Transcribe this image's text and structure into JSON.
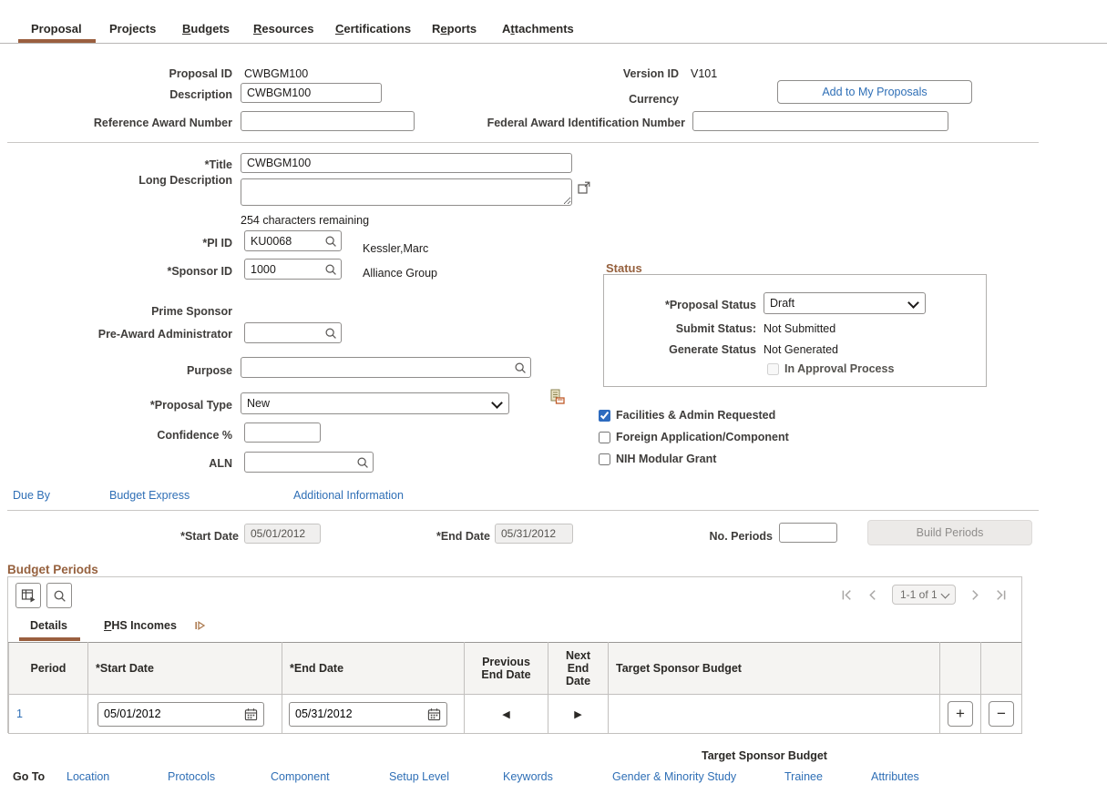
{
  "tabs": {
    "items": [
      {
        "pre": "Proposal",
        "key": "",
        "rest": ""
      },
      {
        "pre": "Projects",
        "key": "",
        "rest": ""
      },
      {
        "pre": "",
        "key": "B",
        "rest": "udgets"
      },
      {
        "pre": "",
        "key": "R",
        "rest": "esources"
      },
      {
        "pre": "",
        "key": "C",
        "rest": "ertifications"
      },
      {
        "pre": "R",
        "key": "e",
        "rest": "ports"
      },
      {
        "pre": "A",
        "key": "t",
        "rest": "tachments"
      }
    ]
  },
  "header": {
    "proposal_id_label": "Proposal ID",
    "proposal_id_value": "CWBGM100",
    "version_id_label": "Version ID",
    "version_id_value": "V101",
    "description_label": "Description",
    "description_value": "CWBGM100",
    "currency_label": "Currency",
    "add_to_my_proposals": "Add to My Proposals",
    "reference_award_label": "Reference Award Number",
    "reference_award_value": "",
    "federal_award_label": "Federal Award Identification Number",
    "federal_award_value": ""
  },
  "details": {
    "title_label": "*Title",
    "title_value": "CWBGM100",
    "long_description_label": "Long Description",
    "long_description_value": "",
    "chars_remaining": "254 characters remaining",
    "pi_id_label": "*PI ID",
    "pi_id_value": "KU0068",
    "pi_name": "Kessler,Marc",
    "sponsor_id_label": "*Sponsor ID",
    "sponsor_id_value": "1000",
    "sponsor_name": "Alliance Group",
    "prime_sponsor_label": "Prime Sponsor",
    "pre_award_admin_label": "Pre-Award Administrator",
    "pre_award_admin_value": "",
    "purpose_label": "Purpose",
    "purpose_value": "",
    "proposal_type_label": "*Proposal Type",
    "proposal_type_value": "New",
    "confidence_label": "Confidence %",
    "confidence_value": "",
    "aln_label": "ALN",
    "aln_value": ""
  },
  "status": {
    "heading": "Status",
    "proposal_status_label": "*Proposal Status",
    "proposal_status_value": "Draft",
    "submit_status_label": "Submit Status:",
    "submit_status_value": "Not Submitted",
    "generate_status_label": "Generate Status",
    "generate_status_value": "Not Generated",
    "in_approval_label": "In Approval Process"
  },
  "flags": [
    {
      "label": "Facilities & Admin Requested",
      "checked": true
    },
    {
      "label": "Foreign Application/Component",
      "checked": false
    },
    {
      "label": "NIH Modular Grant",
      "checked": false
    }
  ],
  "quick_links": [
    "Due By",
    "Budget Express",
    "Additional Information"
  ],
  "period_setup": {
    "start_date_label": "*Start Date",
    "start_date_value": "05/01/2012",
    "end_date_label": "*End Date",
    "end_date_value": "05/31/2012",
    "no_periods_label": "No. Periods",
    "no_periods_value": "",
    "build_periods_label": "Build Periods"
  },
  "budget_periods": {
    "heading": "Budget Periods",
    "tab_details": "Details",
    "tab_phs": {
      "key": "P",
      "rest": "HS Incomes"
    },
    "pagination": "1-1 of 1",
    "columns": [
      "Period",
      "*Start Date",
      "*End Date",
      "Previous End Date",
      "Next End Date",
      "Target Sponsor Budget"
    ],
    "rows": [
      {
        "period": "1",
        "start_date": "05/01/2012",
        "end_date": "05/31/2012"
      }
    ]
  },
  "footer": {
    "target_sponsor_budget_label": "Target Sponsor Budget",
    "go_to_label": "Go To",
    "links": [
      "Location",
      "Protocols",
      "Component",
      "Setup Level",
      "Keywords",
      "Gender & Minority Study",
      "Trainee",
      "Attributes"
    ]
  },
  "icons": {
    "plus": "+",
    "minus": "−",
    "prev": "◀",
    "next": "▶"
  },
  "colors": {
    "accent_brown": "#9A5F3F",
    "heading_brown": "#96613E",
    "link_blue": "#2F6FB6",
    "checkbox_blue": "#2D6BBF"
  }
}
